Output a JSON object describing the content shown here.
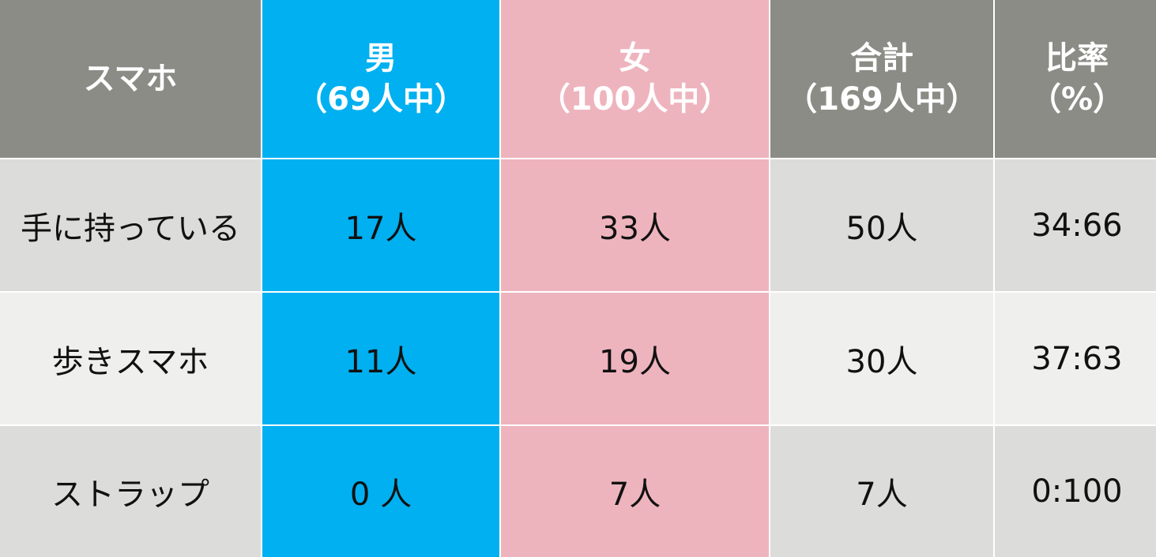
{
  "header": {
    "col0": {
      "line1": "スマホ",
      "line2": ""
    },
    "col1": {
      "line1": "男",
      "line2": "（69人中）"
    },
    "col2": {
      "line1": "女",
      "line2": "（100人中）"
    },
    "col3": {
      "line1": "合計",
      "line2": "（169人中）"
    },
    "col4": {
      "line1": "比率",
      "line2": "（%）"
    }
  },
  "rows": [
    {
      "label": "手に持っている",
      "male": "17人",
      "female": "33人",
      "total": "50人",
      "ratio": "34:66"
    },
    {
      "label": "歩きスマホ",
      "male": "11人",
      "female": "19人",
      "total": "30人",
      "ratio": "37:63"
    },
    {
      "label": "ストラップ",
      "male": "0 人",
      "female": "7人",
      "total": "7人",
      "ratio": "0:100"
    }
  ],
  "colors": {
    "header_gray": "#8c8c87",
    "male_blue": "#00b0f0",
    "female_pink": "#eeb4be",
    "row_light": "#efefed",
    "row_mid": "#dcdcda"
  }
}
